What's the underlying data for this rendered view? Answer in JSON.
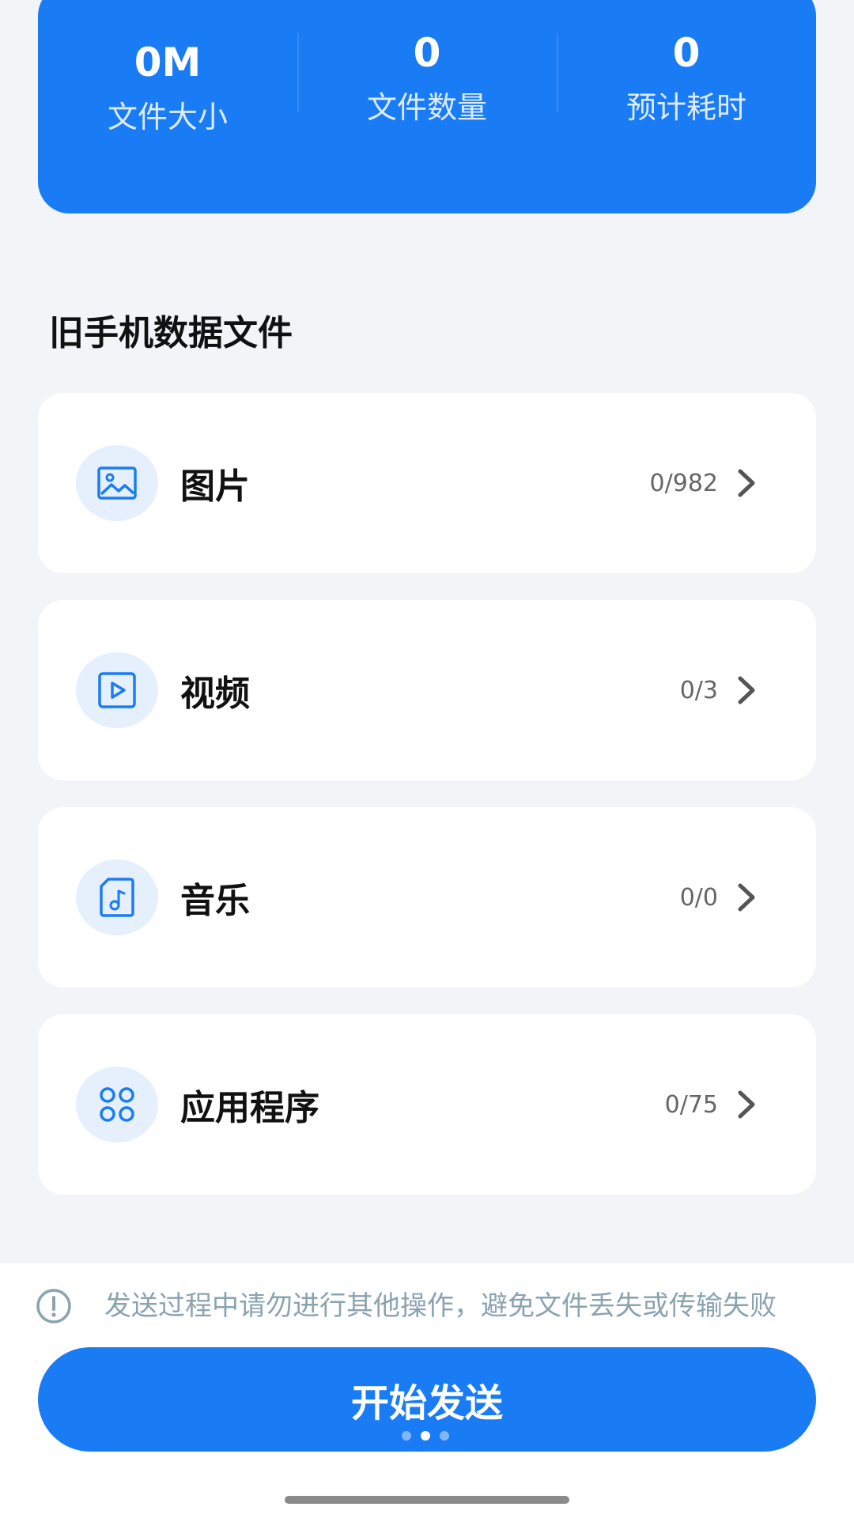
{
  "stats": [
    {
      "value": "0M",
      "label": "文件大小"
    },
    {
      "value": "0",
      "label": "文件数量"
    },
    {
      "value": "0",
      "label": "预计耗时"
    }
  ],
  "section_title": "旧手机数据文件",
  "categories": [
    {
      "label": "图片",
      "count": "0/982",
      "icon": "image-icon"
    },
    {
      "label": "视频",
      "count": "0/3",
      "icon": "video-icon"
    },
    {
      "label": "音乐",
      "count": "0/0",
      "icon": "music-file-icon"
    },
    {
      "label": "应用程序",
      "count": "0/75",
      "icon": "apps-grid-icon"
    }
  ],
  "notice": {
    "text": "发送过程中请勿进行其他操作，避免文件丢失或传输失败",
    "icon": "info-icon"
  },
  "start_button": {
    "label": "开始发送"
  },
  "pager": {
    "total": 3,
    "active": 2
  },
  "colors": {
    "accent": "#1a7cf5",
    "background": "#f2f4f8",
    "icon_bg": "#e6f0fd",
    "notice_text": "#8aa3b0"
  }
}
